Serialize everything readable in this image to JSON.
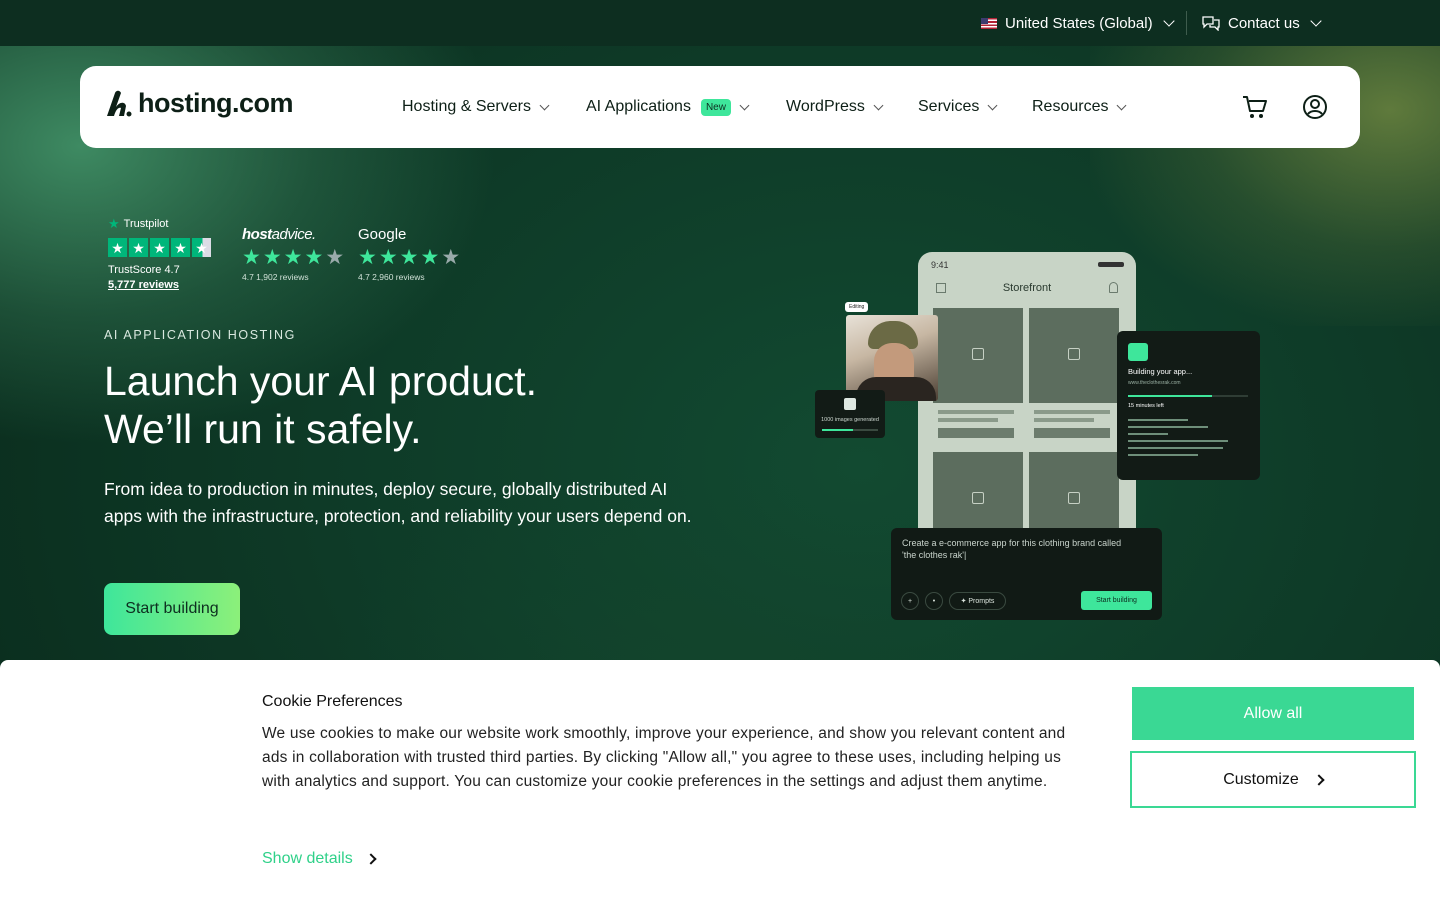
{
  "topbar": {
    "region": "United States (Global)",
    "contact": "Contact us"
  },
  "nav": {
    "logo": "hosting.com",
    "items": [
      {
        "label": "Hosting & Servers"
      },
      {
        "label": "AI Applications",
        "badge": "New"
      },
      {
        "label": "WordPress"
      },
      {
        "label": "Services"
      },
      {
        "label": "Resources"
      }
    ]
  },
  "ratings": {
    "trustpilot": {
      "brand": "Trustpilot",
      "score": "TrustScore 4.7",
      "reviews": "5,777 reviews"
    },
    "hostadvice": {
      "brand_a": "host",
      "brand_b": "advice.",
      "reviews": "4.7 1,902 reviews"
    },
    "google": {
      "brand": "Google",
      "reviews": "4.7 2,960 reviews"
    }
  },
  "hero": {
    "eyebrow": "AI APPLICATION HOSTING",
    "headline_1": "Launch your AI product.",
    "headline_2": "We’ll run it safely.",
    "lead": "From idea to production in minutes, deploy secure, globally distributed AI apps with the infrastructure, protection, and reliability your users depend on.",
    "cta": "Start building"
  },
  "mockup": {
    "time": "9:41",
    "app_title": "Storefront",
    "prompt": "Create a e-commerce app for this clothing brand called 'the clothes rak'|",
    "prompts_pill": "✦ Prompts",
    "start_btn": "Start building",
    "building": "Building your app...",
    "url": "www.theclothesrak.com",
    "time_left": "15 minutes left",
    "images_generated": "1000 images generated",
    "tag": "Editing"
  },
  "cookie": {
    "title": "Cookie Preferences",
    "body": "We use cookies to make our website work smoothly, improve your experience, and show you relevant content and ads in collaboration with trusted third parties. By clicking \"Allow all,\" you agree to these uses, including helping us with analytics and support. You can customize your cookie preferences in the settings and adjust them anytime.",
    "show_details": "Show details",
    "allow_all": "Allow all",
    "customize": "Customize"
  },
  "colors": {
    "accent": "#3ee69b",
    "dark": "#0d2e20",
    "cookie_green": "#3ad894"
  }
}
